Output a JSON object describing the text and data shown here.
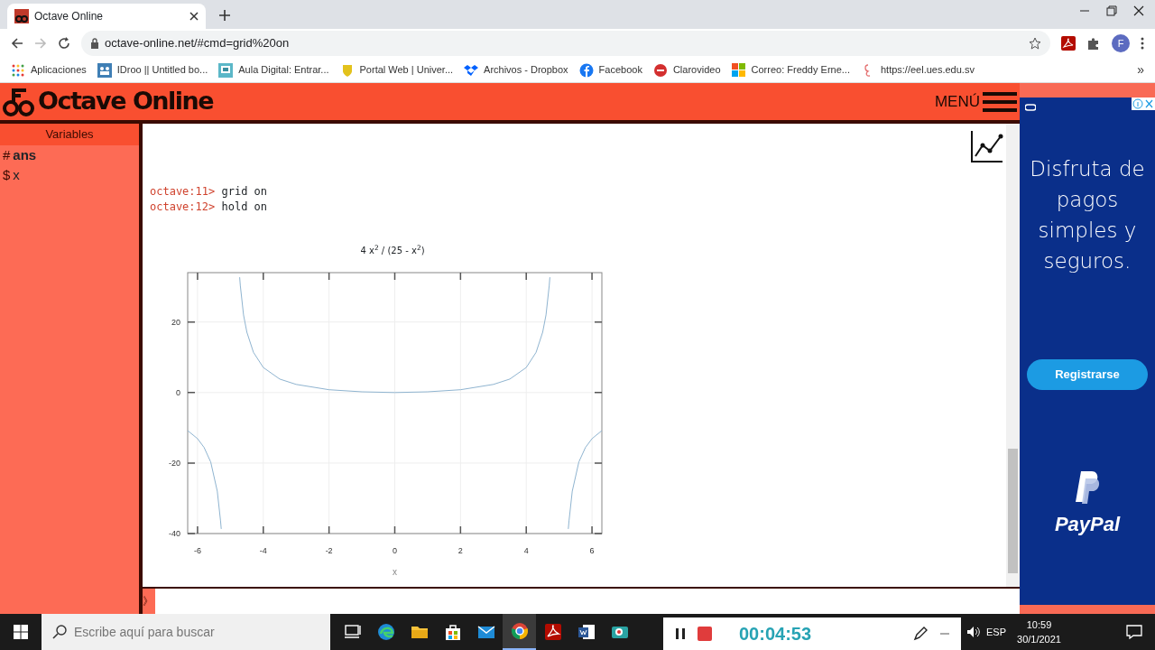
{
  "browser": {
    "tab": {
      "title": "Octave Online",
      "selected": true
    },
    "url": "octave-online.net/#cmd=grid%20on",
    "forward_disabled": true,
    "profile_initial": "F",
    "bookmarks": [
      {
        "kind": "apps",
        "label": "Aplicaciones"
      },
      {
        "kind": "board",
        "label": "IDroo || Untitled bo..."
      },
      {
        "kind": "screen",
        "label": "Aula Digital: Entrar..."
      },
      {
        "kind": "shield",
        "label": "Portal Web | Univer..."
      },
      {
        "kind": "box",
        "label": "Archivos - Dropbox"
      },
      {
        "kind": "round",
        "label": "Facebook"
      },
      {
        "kind": "red",
        "label": "Clarovideo"
      },
      {
        "kind": "tiles",
        "label": "Correo: Freddy Erne..."
      },
      {
        "kind": "sketch",
        "label": "https://eel.ues.edu.sv"
      }
    ],
    "more_bookmarks": "»"
  },
  "app": {
    "brand": "Octave Online",
    "menu_label": "MENÚ",
    "variables": {
      "title": "Variables",
      "items": [
        {
          "symbol": "#",
          "name": "ans",
          "bold": true
        },
        {
          "symbol": "$",
          "name": "x",
          "bold": false
        }
      ]
    },
    "console": {
      "lines": [
        {
          "prompt": "octave:11>",
          "command": "grid on"
        },
        {
          "prompt": "octave:12>",
          "command": "hold on"
        }
      ],
      "chart_data": {
        "type": "line",
        "title": "4 x$^{2}$ / (25 - x$^{2}$)",
        "xlabel": "x",
        "x": [
          -6.3,
          -6,
          -5.8,
          -5.6,
          -5.4,
          -5.3,
          -5.28,
          -4.72,
          -4.7,
          -4.6,
          -4.5,
          -4.3,
          -4,
          -3.5,
          -3,
          -2,
          -1,
          0,
          1,
          2,
          3,
          3.5,
          4,
          4.3,
          4.5,
          4.6,
          4.7,
          4.72,
          5.28,
          5.3,
          5.4,
          5.6,
          5.8,
          6,
          6.3
        ],
        "series": [
          {
            "color": "#8fb4d0",
            "values": [
              -10.8,
              -13.1,
              -15.6,
              -19.7,
              -28,
              -36.4,
              -38.7,
              32.7,
              30.4,
              22,
              17.1,
              11.4,
              7.1,
              3.8,
              2.3,
              0.8,
              0.2,
              0,
              0.2,
              0.8,
              2.3,
              3.8,
              7.1,
              11.4,
              17.1,
              22,
              30.4,
              32.7,
              -38.7,
              -36.4,
              -28,
              -19.7,
              -15.6,
              -13.1,
              -10.8
            ]
          }
        ],
        "xlim": [
          -6.3,
          6.3
        ],
        "ylim": [
          -40,
          34
        ],
        "xticks": [
          -6,
          -4,
          -2,
          0,
          2,
          4,
          6
        ],
        "yticks": [
          -40,
          -20,
          0,
          20
        ],
        "grid": true
      }
    },
    "input_prompt": "》"
  },
  "ad": {
    "headline": "Disfruta de pagos simples y seguros.",
    "button": "Registrarse",
    "brand": "PayPal"
  },
  "taskbar": {
    "search_placeholder": "Escribe aquí para buscar",
    "apps": [
      {
        "kind": "taskview",
        "selected": false
      },
      {
        "kind": "edge",
        "selected": false
      },
      {
        "kind": "folder",
        "selected": false
      },
      {
        "kind": "store",
        "selected": false
      },
      {
        "kind": "mail",
        "selected": false
      },
      {
        "kind": "chrome",
        "selected": true
      },
      {
        "kind": "pdf",
        "selected": false
      },
      {
        "kind": "word",
        "selected": false
      },
      {
        "kind": "camera",
        "selected": false
      }
    ],
    "recorder": {
      "time": "00:04:53"
    },
    "language": "ESP",
    "time": "10:59",
    "date": "30/1/2021"
  }
}
